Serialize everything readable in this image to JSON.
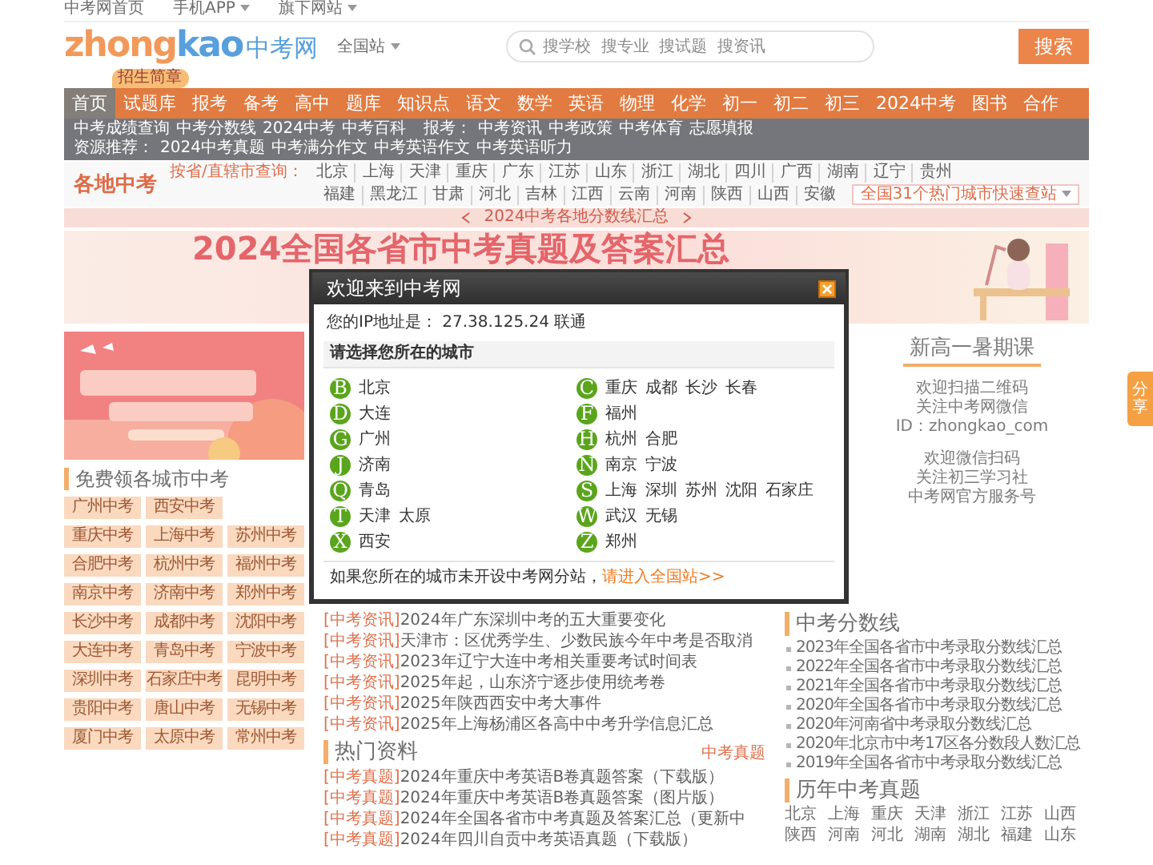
{
  "top_links": [
    {
      "text": "中考网首页",
      "dropdown": false
    },
    {
      "text": "手机APP",
      "dropdown": true
    },
    {
      "text": "旗下网站",
      "dropdown": true
    }
  ],
  "header": {
    "logo_part_1": "zhong",
    "logo_part_2": "kao",
    "logo_cn": "中考网",
    "site_switch": {
      "text": "全国站",
      "dropdown": true
    },
    "search_placeholder": "搜学校  搜专业  搜试题  搜资讯",
    "search_button": "搜索"
  },
  "nav": {
    "items": [
      {
        "label": "首页",
        "selected": true
      },
      {
        "label": "试题库",
        "selected": false,
        "badge": "招生简章"
      },
      {
        "label": "报考",
        "selected": false
      },
      {
        "label": "备考",
        "selected": false
      },
      {
        "label": "高中",
        "selected": false
      },
      {
        "label": "题库",
        "selected": false
      },
      {
        "label": "知识点",
        "selected": false
      },
      {
        "label": "语文",
        "selected": false
      },
      {
        "label": "数学",
        "selected": false
      },
      {
        "label": "英语",
        "selected": false
      },
      {
        "label": "物理",
        "selected": false
      },
      {
        "label": "化学",
        "selected": false
      },
      {
        "label": "初一",
        "selected": false
      },
      {
        "label": "初二",
        "selected": false
      },
      {
        "label": "初三",
        "selected": false
      },
      {
        "label": "2024中考",
        "selected": false
      },
      {
        "label": "图书",
        "selected": false
      },
      {
        "label": "合作",
        "selected": false
      }
    ]
  },
  "subnav": [
    {
      "links": [
        "中考成绩查询",
        "中考分数线",
        "2024中考",
        "中考百科"
      ]
    },
    {
      "label": "报考：",
      "links": [
        "中考资讯",
        "中考政策",
        "中考体育",
        "志愿填报"
      ]
    },
    {
      "label": "资源推荐：",
      "links": [
        "2024中考真题",
        "中考满分作文",
        "中考英语作文",
        "中考英语听力"
      ]
    }
  ],
  "region": {
    "logo": "各地中考",
    "prompt": "按省/直辖市查询：",
    "rows": [
      [
        "北京",
        "上海",
        "天津",
        "重庆",
        "广东",
        "江苏",
        "山东",
        "浙江",
        "湖北",
        "四川",
        "广西",
        "湖南",
        "辽宁",
        "贵州"
      ],
      [
        "福建",
        "黑龙江",
        "甘肃",
        "河北",
        "吉林",
        "江西",
        "云南",
        "河南",
        "陕西",
        "山西",
        "安徽"
      ]
    ],
    "quick_select": {
      "text": "全国31个热门城市快速查站",
      "dropdown": true
    }
  },
  "promo_bar": "2024中考各地分数线汇总",
  "banner": {
    "title": "2024全国各省市中考真题及答案汇总"
  },
  "left": {
    "ad": {
      "kind": "picture"
    },
    "heading": "免费领各城市中考",
    "city_buttons": [
      [
        "广州中考",
        "西安中考"
      ],
      [
        "重庆中考",
        "上海中考",
        "苏州中考"
      ],
      [
        "合肥中考",
        "杭州中考",
        "福州中考"
      ],
      [
        "南京中考",
        "济南中考",
        "郑州中考"
      ],
      [
        "长沙中考",
        "成都中考",
        "沈阳中考"
      ],
      [
        "大连中考",
        "青岛中考",
        "宁波中考"
      ],
      [
        "深圳中考",
        "石家庄中考",
        "昆明中考"
      ],
      [
        "贵阳中考",
        "唐山中考",
        "无锡中考"
      ],
      [
        "厦门中考",
        "太原中考",
        "常州中考"
      ]
    ]
  },
  "middle": {
    "news": [
      {
        "tag": "[中考资讯]",
        "title": "2024年广东深圳中考的五大重要变化"
      },
      {
        "tag": "[中考资讯]",
        "title": "天津市：区优秀学生、少数民族今年中考是否取消"
      },
      {
        "tag": "[中考资讯]",
        "title": "2023年辽宁大连中考相关重要考试时间表"
      },
      {
        "tag": "[中考资讯]",
        "title": "2025年起，山东济宁逐步使用统考卷"
      },
      {
        "tag": "[中考资讯]",
        "title": "2025年陕西西安中考大事件"
      },
      {
        "tag": "[中考资讯]",
        "title": "2025年上海杨浦区各高中中考升学信息汇总"
      }
    ],
    "hot": {
      "heading": "热门资料",
      "more": "中考真题",
      "items": [
        {
          "tag": "[中考真题]",
          "title": "2024年重庆中考英语B卷真题答案（下载版）"
        },
        {
          "tag": "[中考真题]",
          "title": "2024年重庆中考英语B卷真题答案（图片版）"
        },
        {
          "tag": "[中考真题]",
          "title": "2024年全国各省市中考真题及答案汇总（更新中"
        },
        {
          "tag": "[中考真题]",
          "title": "2024年四川自贡中考英语真题（下载版）"
        }
      ]
    }
  },
  "right": {
    "tab": "新高一暑期课",
    "qr_notes": [
      [
        "欢迎扫描二维码",
        "关注中考网微信",
        "ID：zhongkao_com"
      ],
      [
        "欢迎微信扫码",
        "关注初三学习社",
        "中考网官方服务号"
      ]
    ],
    "scores": {
      "heading": "中考分数线",
      "items": [
        "2023年全国各省市中考录取分数线汇总",
        "2022年全国各省市中考录取分数线汇总",
        "2021年全国各省市中考录取分数线汇总",
        "2020年全国各省市中考录取分数线汇总",
        "2020年河南省中考录取分数线汇总",
        "2020年北京市中考17区各分数段人数汇总",
        "2019年全国各省市中考录取分数线汇总"
      ]
    },
    "papers": {
      "heading": "历年中考真题",
      "provinces": [
        "北京",
        "上海",
        "重庆",
        "天津",
        "浙江",
        "江苏",
        "山西",
        "陕西",
        "河南",
        "河北",
        "湖南",
        "湖北",
        "福建",
        "山东"
      ]
    }
  },
  "share": "分享",
  "modal": {
    "title": "欢迎来到中考网",
    "ip_text": "您的IP地址是： 27.38.125.24 联通",
    "prompt": "请选择您所在的城市",
    "groups": [
      {
        "letter": "B",
        "cities": [
          "北京"
        ]
      },
      {
        "letter": "C",
        "cities": [
          "重庆",
          "成都",
          "长沙",
          "长春"
        ]
      },
      {
        "letter": "D",
        "cities": [
          "大连"
        ]
      },
      {
        "letter": "F",
        "cities": [
          "福州"
        ]
      },
      {
        "letter": "G",
        "cities": [
          "广州"
        ]
      },
      {
        "letter": "H",
        "cities": [
          "杭州",
          "合肥"
        ]
      },
      {
        "letter": "J",
        "cities": [
          "济南"
        ]
      },
      {
        "letter": "N",
        "cities": [
          "南京",
          "宁波"
        ]
      },
      {
        "letter": "Q",
        "cities": [
          "青岛"
        ]
      },
      {
        "letter": "S",
        "cities": [
          "上海",
          "深圳",
          "苏州",
          "沈阳",
          "石家庄"
        ]
      },
      {
        "letter": "T",
        "cities": [
          "天津",
          "太原"
        ]
      },
      {
        "letter": "W",
        "cities": [
          "武汉",
          "无锡"
        ]
      },
      {
        "letter": "X",
        "cities": [
          "西安"
        ]
      },
      {
        "letter": "Z",
        "cities": [
          "郑州"
        ]
      }
    ],
    "footer": "如果您所在的城市未开设中考网分站，",
    "footer_link": "请进入全国站>>"
  }
}
